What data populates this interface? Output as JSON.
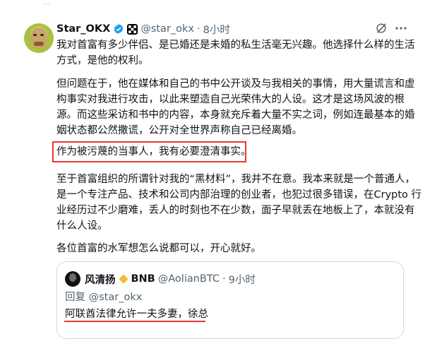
{
  "ghost_top": "...",
  "post": {
    "name": "Star_OKX",
    "handle": "@star_okx",
    "separator": "·",
    "time": "8小时",
    "paragraphs": [
      "我对首富有多少伴侣、是已婚还是未婚的私生活毫无兴趣。他选择什么样的生活方式，是他的权利。",
      "但问题在于，他在媒体和自己的书中公开谈及与我相关的事情，用大量谎言和虚构事实对我进行攻击，以此来塑造自己光荣伟大的人设。这才是这场风波的根源。而这些采访和书中的内容，本身就充斥着大量不实之词，例如连最基本的婚姻状态都公然撒谎，公开对全世界声称自己已经离婚。",
      "作为被污蔑的当事人，我有必要澄清事实。",
      "至于首富组织的所谓针对我的“黑材料”，我并不在意。我本来就是一个普通人，是一个专注产品、技术和公司内部治理的创业者，也犯过很多错误，在Crypto 行业经历过不少磨难，丢人的时刻也不在少数，面子早就丢在地板上了，本就没有什么人设。",
      "各位首富的水军想怎么说都可以，开心就好。"
    ]
  },
  "quote": {
    "name": "风清扬",
    "badge_text": "BNB",
    "handle": "@AolianBTC",
    "separator": "·",
    "time": "9小时",
    "reply_prefix": "回复",
    "reply_to": "@star_okx",
    "text": "阿联酋法律允许一夫多妻，徐总"
  },
  "colors": {
    "highlight_red": "#e53935",
    "verified_blue": "#1d9bf0",
    "bnb_gold": "#f3ba2f"
  }
}
